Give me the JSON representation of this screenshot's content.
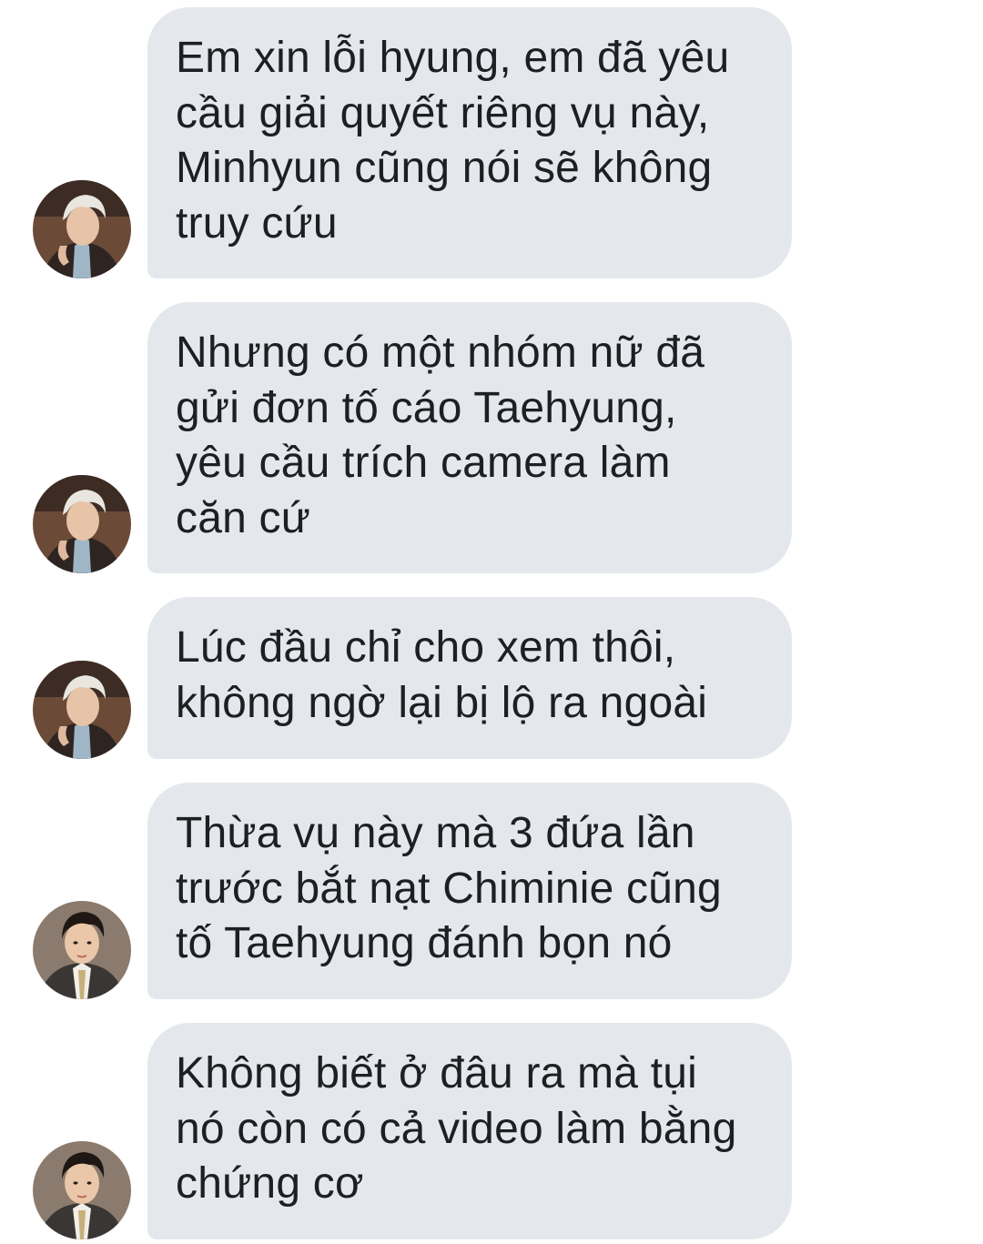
{
  "messages": [
    {
      "sender_avatar": "avatar-light-hair",
      "text": "Em xin lỗi hyung, em đã yêu\ncầu giải quyết riêng vụ này,\nMinhyun cũng nói sẽ không\ntruy cứu"
    },
    {
      "sender_avatar": "avatar-light-hair",
      "text": "Nhưng có một nhóm nữ đã\ngửi đơn tố cáo Taehyung,\nyêu cầu trích camera làm\ncăn cứ"
    },
    {
      "sender_avatar": "avatar-light-hair",
      "text": "Lúc đầu chỉ cho xem thôi,\nkhông ngờ lại bị lộ ra ngoài"
    },
    {
      "sender_avatar": "avatar-dark-hair",
      "text": "Thừa vụ này mà 3 đứa lần\ntrước bắt nạt Chiminie cũng\ntố Taehyung đánh bọn nó"
    },
    {
      "sender_avatar": "avatar-dark-hair",
      "text": "Không biết ở đâu ra mà tụi\nnó còn có cả video làm bằng\nchứng cơ"
    }
  ],
  "colors": {
    "bubble": "#e4e8ec",
    "text": "#1d1f22",
    "background": "#ffffff"
  }
}
